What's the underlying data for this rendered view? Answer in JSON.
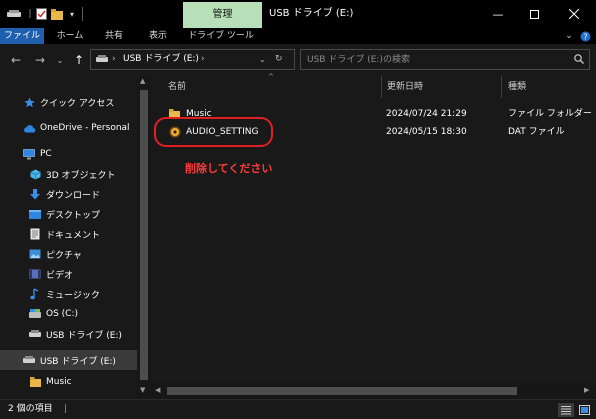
{
  "window": {
    "context_tab": "管理",
    "title": "USB ドライブ (E:)"
  },
  "ribbon": {
    "tabs": [
      "ファイル",
      "ホーム",
      "共有",
      "表示",
      "ドライブ ツール"
    ]
  },
  "address": {
    "path": "USB ドライブ (E:)",
    "search_placeholder": "USB ドライブ (E:)の検索"
  },
  "sidebar": {
    "items": [
      {
        "label": "クイック アクセス",
        "icon": "star-icon"
      },
      {
        "label": "OneDrive - Personal",
        "icon": "cloud-icon"
      },
      {
        "label": "PC",
        "icon": "pc-icon"
      },
      {
        "label": "3D オブジェクト",
        "icon": "cube-icon"
      },
      {
        "label": "ダウンロード",
        "icon": "download-icon"
      },
      {
        "label": "デスクトップ",
        "icon": "desktop-icon"
      },
      {
        "label": "ドキュメント",
        "icon": "document-icon"
      },
      {
        "label": "ピクチャ",
        "icon": "picture-icon"
      },
      {
        "label": "ビデオ",
        "icon": "video-icon"
      },
      {
        "label": "ミュージック",
        "icon": "music-icon"
      },
      {
        "label": "OS (C:)",
        "icon": "drive-icon"
      },
      {
        "label": "USB ドライブ (E:)",
        "icon": "usb-drive-icon"
      },
      {
        "label": "USB ドライブ (E:)",
        "icon": "usb-drive-icon"
      },
      {
        "label": "Music",
        "icon": "folder-icon"
      }
    ]
  },
  "columns": {
    "name": "名前",
    "date": "更新日時",
    "type": "種類"
  },
  "files": [
    {
      "name": "Music",
      "date": "2024/07/24 21:29",
      "type": "ファイル フォルダー",
      "icon": "folder-icon"
    },
    {
      "name": "AUDIO_SETTING",
      "date": "2024/05/15 18:30",
      "type": "DAT ファイル",
      "icon": "dat-file-icon"
    }
  ],
  "annotation": "削除してください",
  "status": {
    "count": "2 個の項目"
  },
  "colors": {
    "background": "#191919",
    "context_tab": "#b8e0b8",
    "file_tab": "#1f5fb0",
    "annotation_red": "#e02020",
    "folder_yellow": "#e8b84a"
  }
}
